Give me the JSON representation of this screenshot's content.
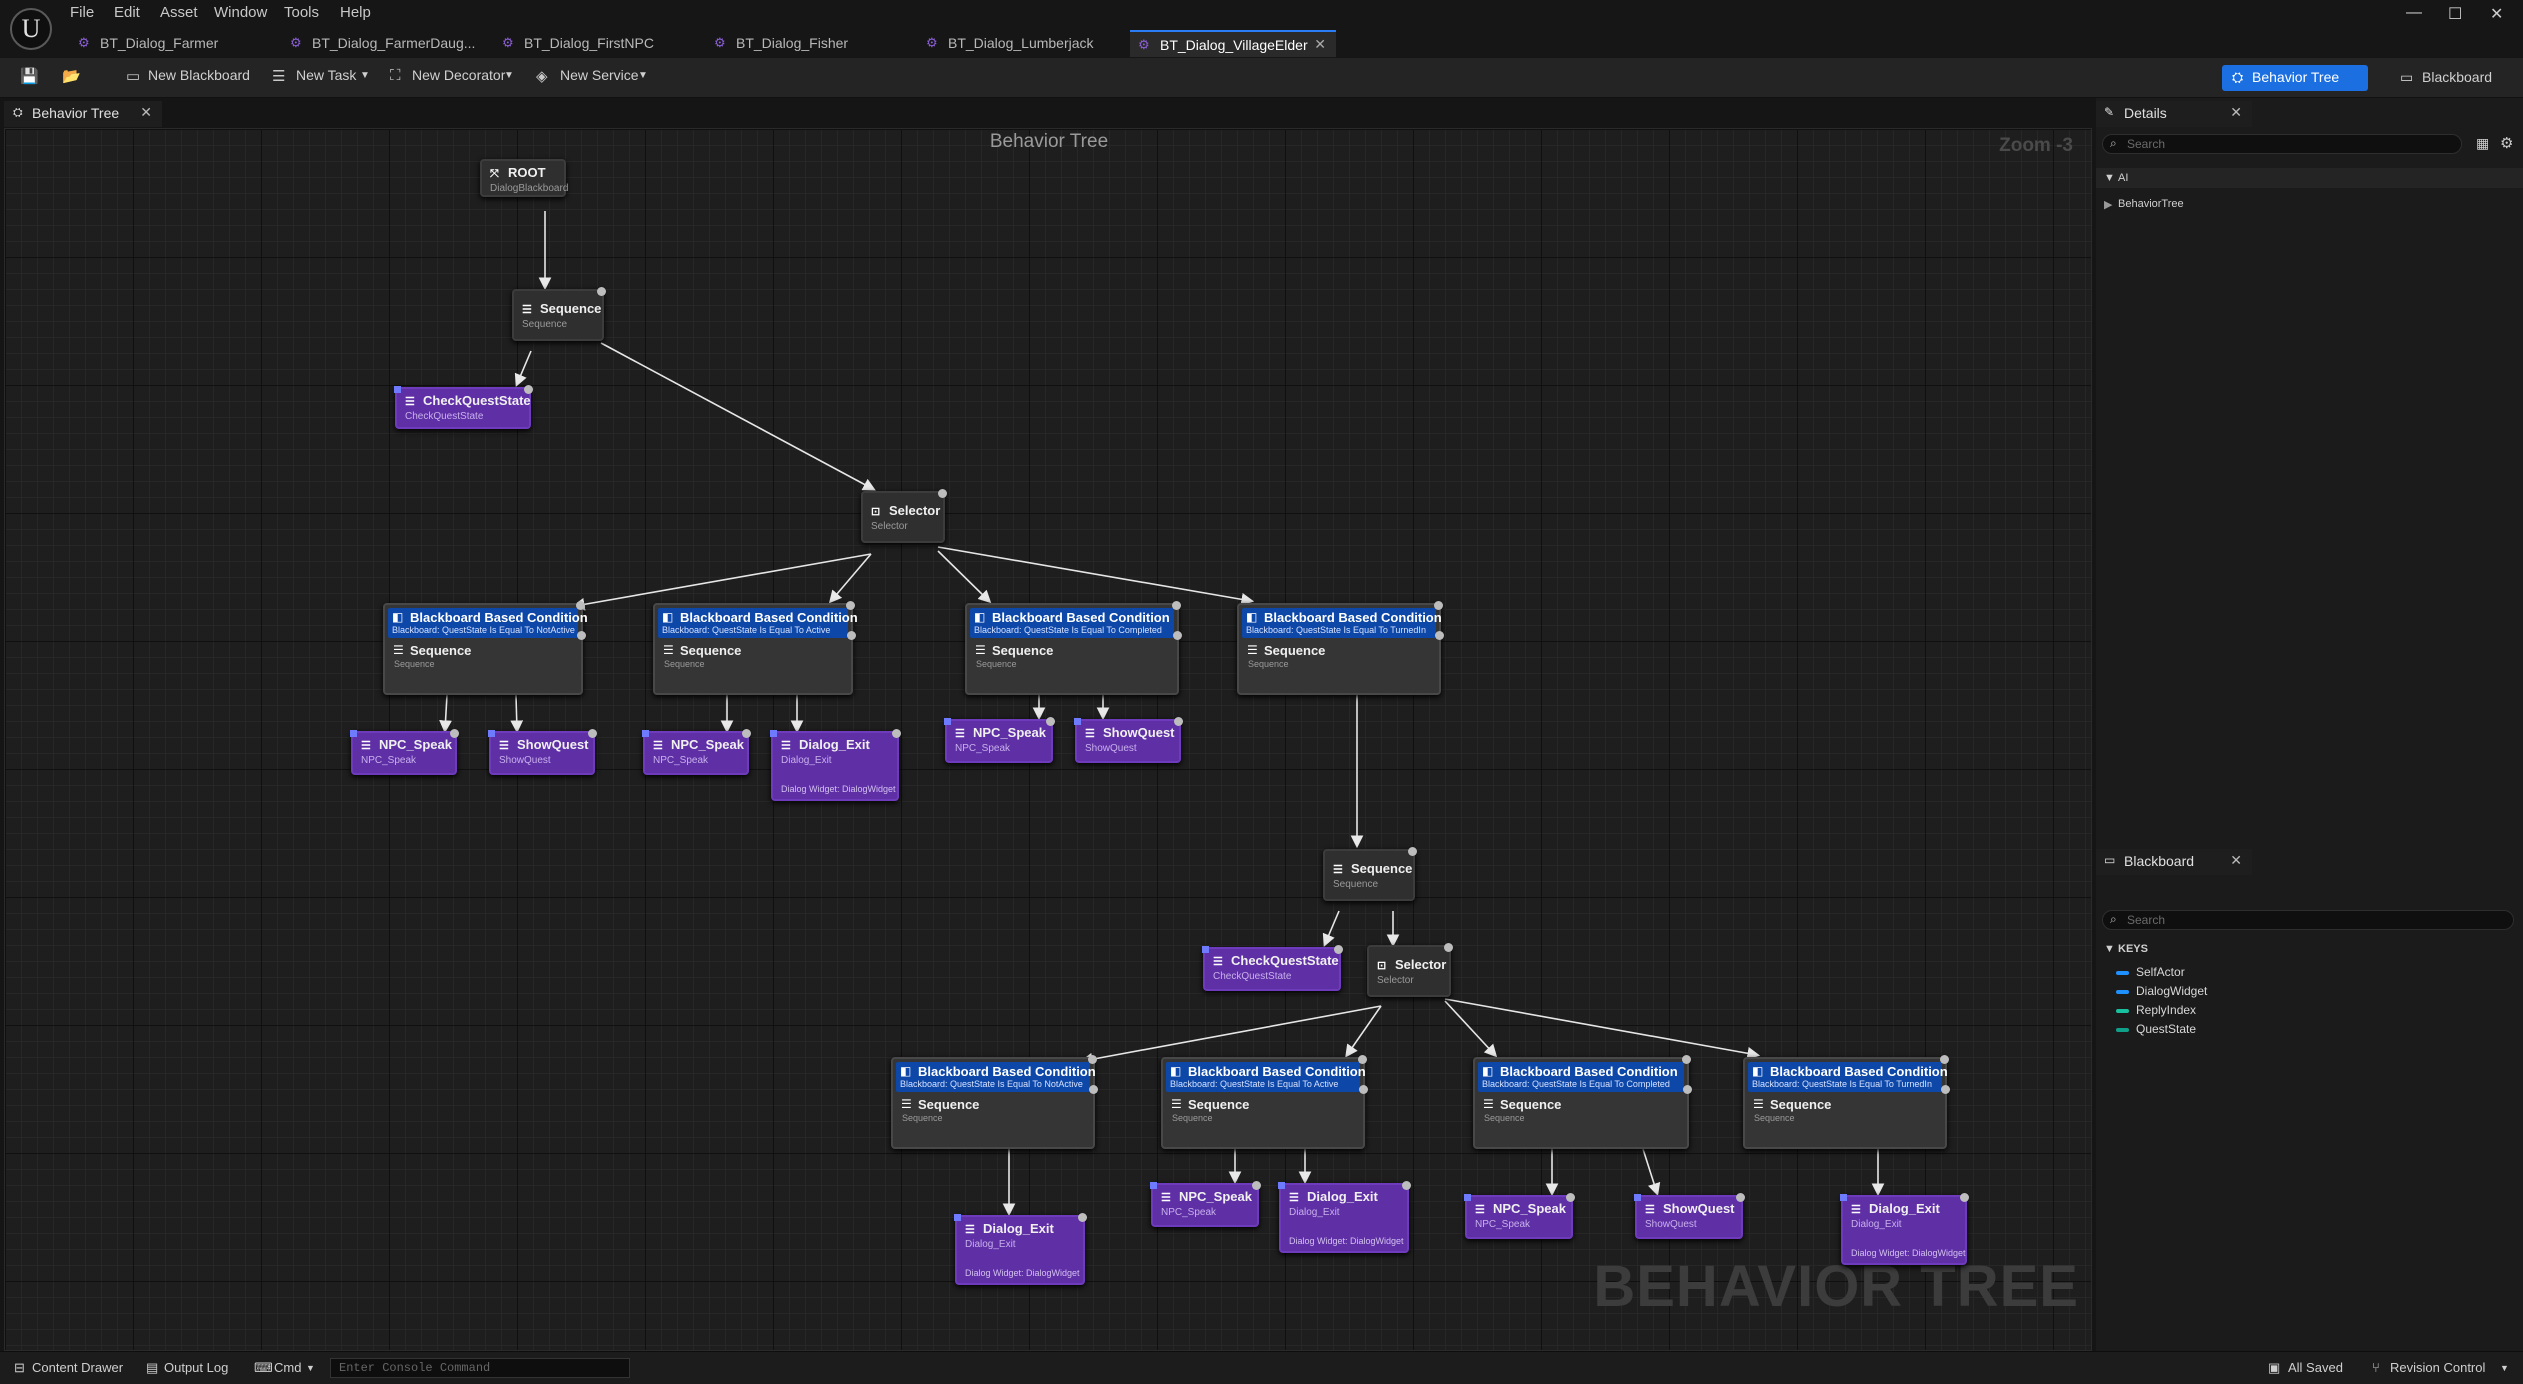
{
  "menu": [
    "File",
    "Edit",
    "Asset",
    "Window",
    "Tools",
    "Help"
  ],
  "tabs": [
    {
      "label": "BT_Dialog_Farmer"
    },
    {
      "label": "BT_Dialog_FarmerDaug..."
    },
    {
      "label": "BT_Dialog_FirstNPC"
    },
    {
      "label": "BT_Dialog_Fisher"
    },
    {
      "label": "BT_Dialog_Lumberjack"
    },
    {
      "label": "BT_Dialog_VillageElder",
      "active": true
    }
  ],
  "toolbar": {
    "new_blackboard": "New Blackboard",
    "new_task": "New Task",
    "new_decorator": "New Decorator",
    "new_service": "New Service",
    "behavior_tree": "Behavior Tree",
    "blackboard": "Blackboard"
  },
  "editor_tab": "Behavior Tree",
  "graph": {
    "title": "Behavior Tree",
    "zoom": "Zoom -3",
    "watermark": "BEHAVIOR TREE",
    "nodes": {
      "root": {
        "title": "ROOT",
        "sub": "DialogBlackboard"
      },
      "seq1": {
        "title": "Sequence",
        "sub": "Sequence"
      },
      "cqs1": {
        "title": "CheckQuestState",
        "sub": "CheckQuestState"
      },
      "sel1": {
        "title": "Selector",
        "sub": "Selector"
      },
      "c1": {
        "dec": "Blackboard Based Condition",
        "dec_sub": "Blackboard: QuestState Is Equal To NotActive",
        "seq": "Sequence",
        "seq_sub": "Sequence"
      },
      "c2": {
        "dec": "Blackboard Based Condition",
        "dec_sub": "Blackboard: QuestState Is Equal To Active",
        "seq": "Sequence",
        "seq_sub": "Sequence"
      },
      "c3": {
        "dec": "Blackboard Based Condition",
        "dec_sub": "Blackboard: QuestState Is Equal To Completed",
        "seq": "Sequence",
        "seq_sub": "Sequence"
      },
      "c4": {
        "dec": "Blackboard Based Condition",
        "dec_sub": "Blackboard: QuestState Is Equal To TurnedIn",
        "seq": "Sequence",
        "seq_sub": "Sequence"
      },
      "t1": {
        "title": "NPC_Speak",
        "sub": "NPC_Speak"
      },
      "t2": {
        "title": "ShowQuest",
        "sub": "ShowQuest"
      },
      "t3": {
        "title": "NPC_Speak",
        "sub": "NPC_Speak"
      },
      "t4": {
        "title": "Dialog_Exit",
        "sub": "Dialog_Exit",
        "extra": "Dialog Widget: DialogWidget"
      },
      "t5": {
        "title": "NPC_Speak",
        "sub": "NPC_Speak"
      },
      "t6": {
        "title": "ShowQuest",
        "sub": "ShowQuest"
      },
      "seq2": {
        "title": "Sequence",
        "sub": "Sequence"
      },
      "cqs2": {
        "title": "CheckQuestState",
        "sub": "CheckQuestState"
      },
      "sel2": {
        "title": "Selector",
        "sub": "Selector"
      },
      "c5": {
        "dec": "Blackboard Based Condition",
        "dec_sub": "Blackboard: QuestState Is Equal To NotActive",
        "seq": "Sequence",
        "seq_sub": "Sequence"
      },
      "c6": {
        "dec": "Blackboard Based Condition",
        "dec_sub": "Blackboard: QuestState Is Equal To Active",
        "seq": "Sequence",
        "seq_sub": "Sequence"
      },
      "c7": {
        "dec": "Blackboard Based Condition",
        "dec_sub": "Blackboard: QuestState Is Equal To Completed",
        "seq": "Sequence",
        "seq_sub": "Sequence"
      },
      "c8": {
        "dec": "Blackboard Based Condition",
        "dec_sub": "Blackboard: QuestState Is Equal To TurnedIn",
        "seq": "Sequence",
        "seq_sub": "Sequence"
      },
      "t7": {
        "title": "Dialog_Exit",
        "sub": "Dialog_Exit",
        "extra": "Dialog Widget: DialogWidget"
      },
      "t8": {
        "title": "NPC_Speak",
        "sub": "NPC_Speak"
      },
      "t9": {
        "title": "Dialog_Exit",
        "sub": "Dialog_Exit",
        "extra": "Dialog Widget: DialogWidget"
      },
      "t10": {
        "title": "NPC_Speak",
        "sub": "NPC_Speak"
      },
      "t11": {
        "title": "ShowQuest",
        "sub": "ShowQuest"
      },
      "t12": {
        "title": "Dialog_Exit",
        "sub": "Dialog_Exit",
        "extra": "Dialog Widget: DialogWidget"
      }
    }
  },
  "details": {
    "tab": "Details",
    "search_placeholder": "Search",
    "category": "AI",
    "item": "BehaviorTree"
  },
  "blackboard": {
    "tab": "Blackboard",
    "search_placeholder": "Search",
    "keys_header": "KEYS",
    "keys": [
      {
        "name": "SelfActor",
        "color": "#1e90ff"
      },
      {
        "name": "DialogWidget",
        "color": "#1e90ff"
      },
      {
        "name": "ReplyIndex",
        "color": "#18c0a0"
      },
      {
        "name": "QuestState",
        "color": "#0fa08a"
      }
    ]
  },
  "status": {
    "content_drawer": "Content Drawer",
    "output_log": "Output Log",
    "cmd": "Cmd",
    "console_placeholder": "Enter Console Command",
    "all_saved": "All Saved",
    "revision_control": "Revision Control"
  }
}
